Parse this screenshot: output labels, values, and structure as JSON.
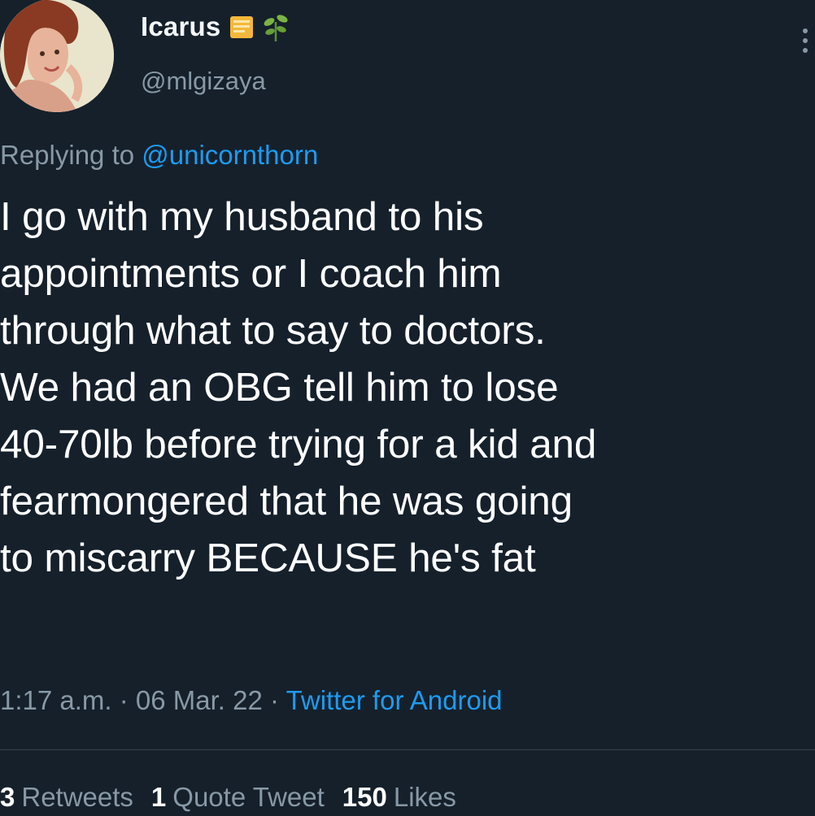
{
  "author": {
    "display_name": "Icarus",
    "handle": "@mlgizaya",
    "badge_icon": "notepad-emoji-icon",
    "sprout_icon": "seedling-emoji-icon"
  },
  "reply": {
    "prefix": "Replying to ",
    "mention": "@unicornthorn"
  },
  "tweet": {
    "text": "I go with my husband to his\nappointments or I coach him\nthrough what to say to doctors.\nWe had an OBG  tell him to lose\n40-70lb before trying for a kid and\nfearmongered that he was going\nto miscarry BECAUSE he's fat"
  },
  "meta": {
    "time": "1:17 a.m.",
    "separator": " · ",
    "date": "06 Mar. 22",
    "source": "Twitter for Android"
  },
  "stats": {
    "retweets_count": "3",
    "retweets_label": "Retweets",
    "quotes_count": "1",
    "quotes_label": "Quote Tweet",
    "likes_count": "150",
    "likes_label": "Likes"
  },
  "colors": {
    "background": "#15202b",
    "text": "#ffffff",
    "secondary": "#8899a6",
    "accent": "#1d9bf0"
  }
}
